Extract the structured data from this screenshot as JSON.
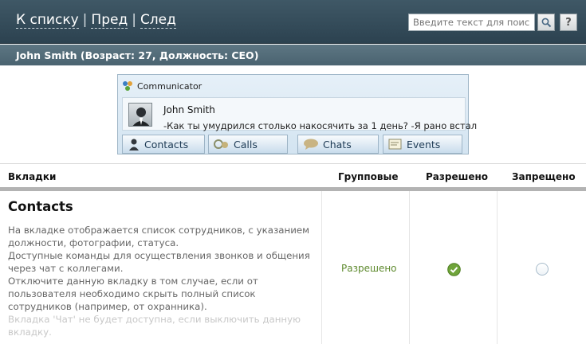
{
  "nav": {
    "back": "К списку",
    "prev": "Пред",
    "next": "След",
    "separator": "|"
  },
  "search": {
    "placeholder": "Введите текст для поиска",
    "help_label": "?"
  },
  "subheader": {
    "title": "John Smith (Возраст: 27, Должность: CEO)"
  },
  "communicator": {
    "title": "Communicator",
    "contact_name": "John Smith",
    "status_text": "-Как ты умудрился столько накосячить за 1 день? -Я рано встал",
    "tabs": [
      {
        "label": "Contacts",
        "icon": "contacts-icon"
      },
      {
        "label": "Calls",
        "icon": "calls-icon"
      },
      {
        "label": "Chats",
        "icon": "chats-icon"
      },
      {
        "label": "Events",
        "icon": "events-icon"
      }
    ]
  },
  "table": {
    "headers": {
      "tabs": "Вкладки",
      "group": "Групповые",
      "allowed": "Разрешено",
      "denied": "Запрещено"
    },
    "rows": [
      {
        "title": "Contacts",
        "desc": [
          "На вкладке отображается список сотрудников, с указанием должности, фотографии, статуса.",
          "Доступные команды для осуществления звонков и общения через чат с коллегами.",
          "Отключите данную вкладку в том случае, если от пользователя необходимо скрыть полный список сотрудников (например, от охранника).",
          "Вкладка 'Чат' не будет доступна, если выключить данную вкладку."
        ],
        "group_value": "Разрешено",
        "allowed_checked": true,
        "denied_checked": false
      }
    ]
  },
  "colors": {
    "header": "#34495a",
    "subheader": "#516b78",
    "accent_green": "#5e8a2e",
    "check_green": "#6fa43a"
  }
}
